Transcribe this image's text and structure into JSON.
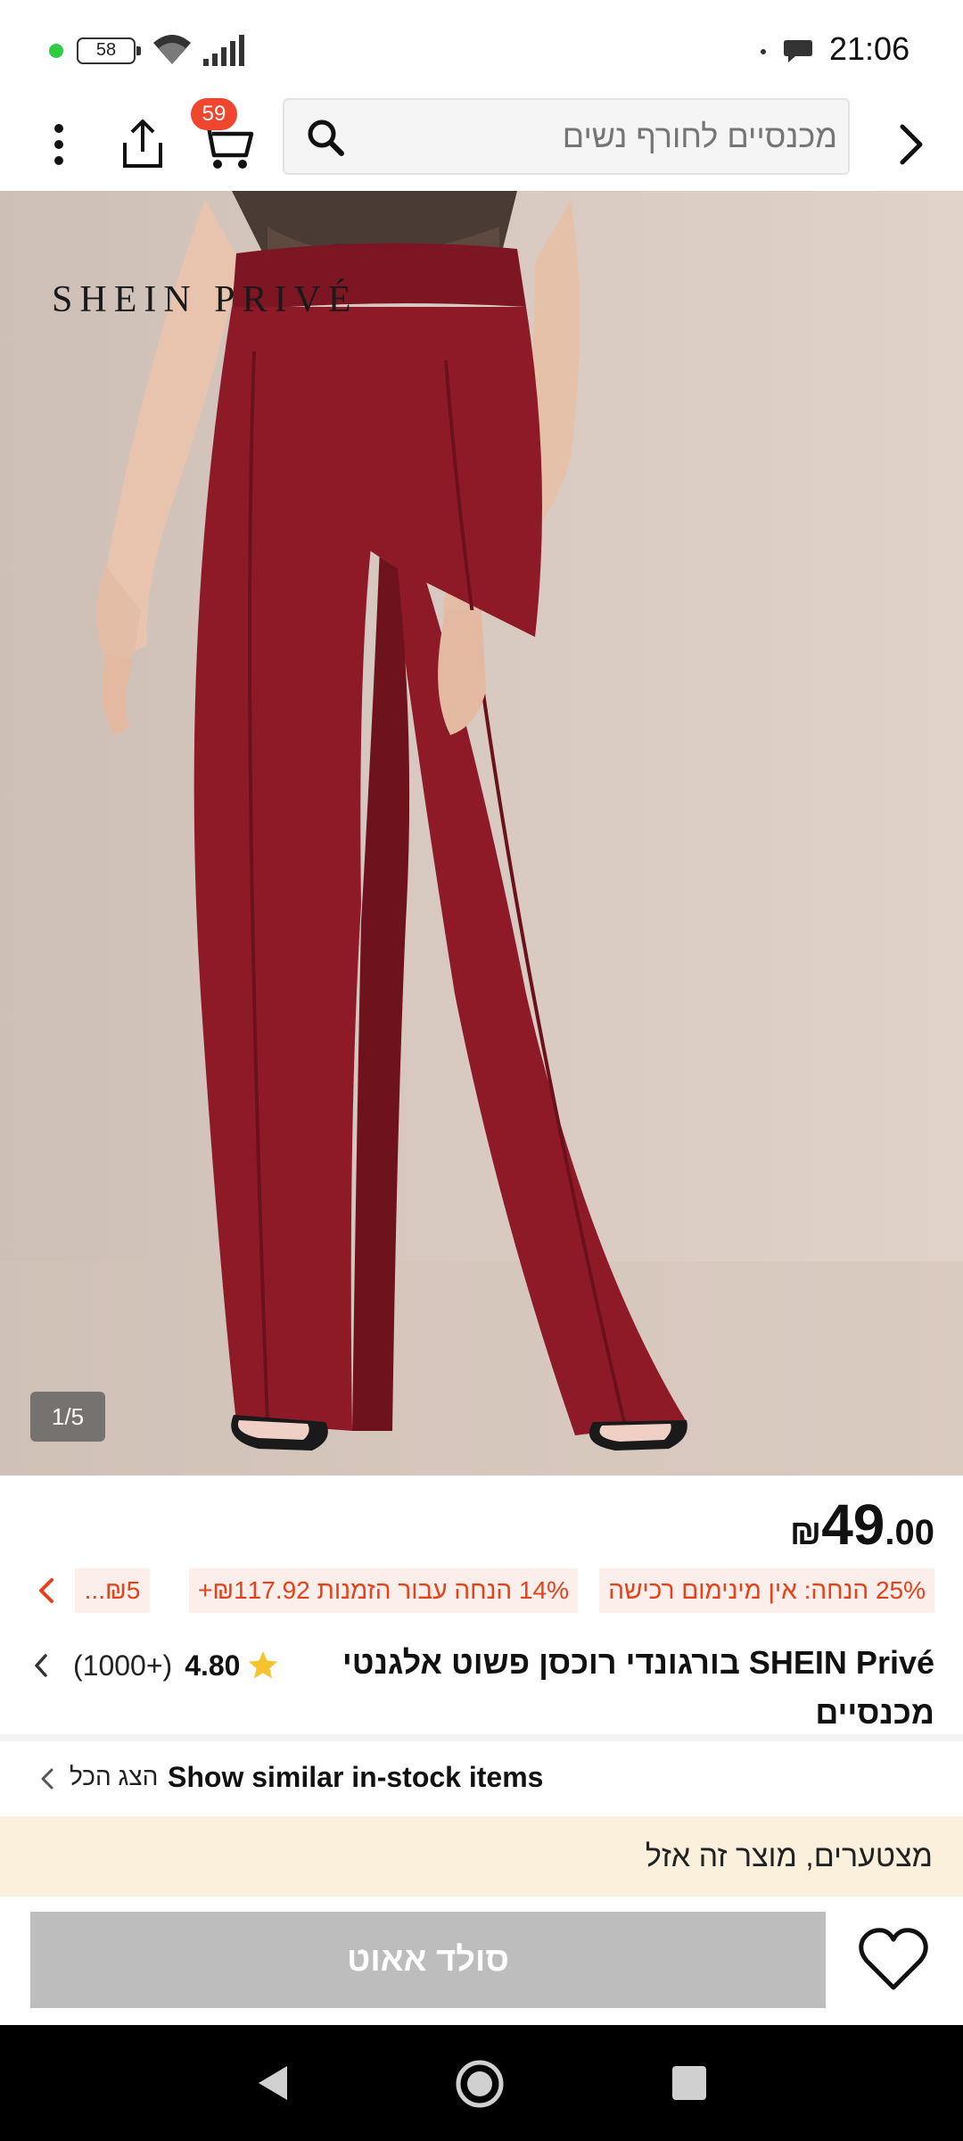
{
  "status_bar": {
    "battery": "58",
    "time": "21:06"
  },
  "toolbar": {
    "cart_count": "59",
    "search_placeholder": "מכנסיים לחורף נשים"
  },
  "product_image": {
    "brand_watermark": "SHEIN PRIVÉ",
    "counter": "1/5",
    "garment_color": "#8e1a28"
  },
  "product": {
    "price": {
      "currency": "₪",
      "integer": "49",
      "decimal": ".00"
    },
    "promos": [
      "25% הנחה: אין מינימום רכישה",
      "14% הנחה עבור הזמנות ₪117.92+",
      "₪5..."
    ],
    "title": "SHEIN Privé בורגונדי רוכסן פשוט אלגנטי מכנסיים",
    "rating": {
      "score": "4.80",
      "count": "(1000+)"
    }
  },
  "similar": {
    "label": "Show similar in-stock items",
    "view_all": "הצג הכל"
  },
  "soldout_banner": {
    "text": "מצטערים, מוצר זה אזל"
  },
  "bottom_bar": {
    "soldout_button": "סולד אאוט"
  },
  "colors": {
    "accent": "#f0462d",
    "promo_text": "#e4421a",
    "promo_bg": "#fceeea",
    "soldout_bg": "#faf0dc",
    "star": "#f6c22e"
  }
}
